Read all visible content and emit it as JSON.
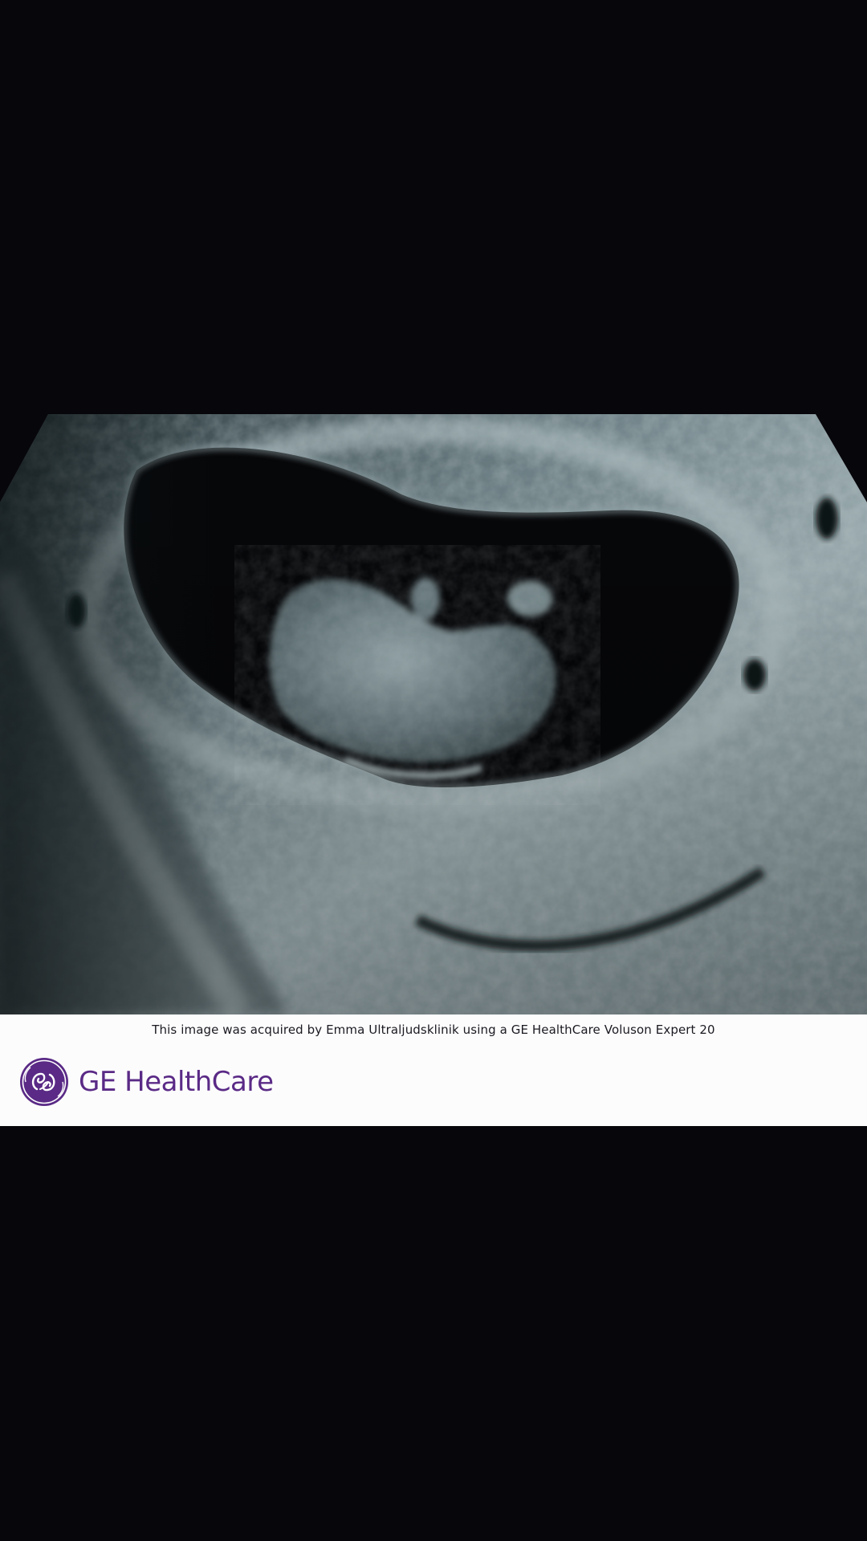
{
  "image": {
    "subject": "ultrasound-scan"
  },
  "caption": {
    "text": "This image was acquired by Emma Ultraljudsklinik using a GE HealthCare Voluson Expert 20"
  },
  "brand": {
    "logo_icon": "ge-monogram-icon",
    "name": "GE HealthCare",
    "color": "#5a2a86"
  },
  "colors": {
    "background": "#07060b",
    "panel": "#fcfcfc"
  }
}
